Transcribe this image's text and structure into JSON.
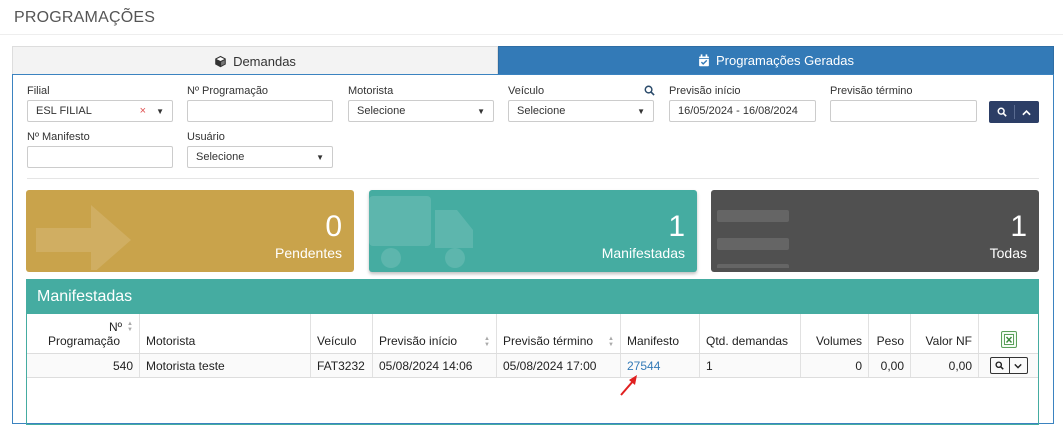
{
  "page": {
    "title": "PROGRAMAÇÕES"
  },
  "tabs": [
    {
      "label": "Demandas",
      "icon": "cube-icon",
      "active": false
    },
    {
      "label": "Programações Geradas",
      "icon": "calendar-check-icon",
      "active": true
    }
  ],
  "filters": {
    "filial": {
      "label": "Filial",
      "value": "ESL FILIAL",
      "clear": "×"
    },
    "n_programacao": {
      "label": "Nº Programação",
      "value": ""
    },
    "motorista": {
      "label": "Motorista",
      "value": "Selecione"
    },
    "veiculo": {
      "label": "Veículo",
      "value": "Selecione",
      "icon": "search-icon"
    },
    "previsao_inicio": {
      "label": "Previsão início",
      "value": "16/05/2024 - 16/08/2024"
    },
    "previsao_termino": {
      "label": "Previsão término",
      "value": ""
    },
    "n_manifesto": {
      "label": "Nº Manifesto",
      "value": ""
    },
    "usuario": {
      "label": "Usuário",
      "value": "Selecione"
    }
  },
  "cards": [
    {
      "count": "0",
      "label": "Pendentes",
      "color": "#c9a34b",
      "icon": "arrow-right-icon"
    },
    {
      "count": "1",
      "label": "Manifestadas",
      "color": "#45aca1",
      "icon": "truck-icon"
    },
    {
      "count": "1",
      "label": "Todas",
      "color": "#505050",
      "icon": "list-icon"
    }
  ],
  "manifestadas": {
    "title": "Manifestadas",
    "columns": {
      "n_programacao_1": "Nº",
      "n_programacao_2": "Programação",
      "motorista": "Motorista",
      "veiculo": "Veículo",
      "previsao_inicio": "Previsão início",
      "previsao_termino": "Previsão término",
      "manifesto": "Manifesto",
      "qtd_demandas": "Qtd. demandas",
      "volumes": "Volumes",
      "peso": "Peso",
      "valor_nf": "Valor NF"
    },
    "rows": [
      {
        "n_programacao": "540",
        "motorista": "Motorista teste",
        "veiculo": "FAT3232",
        "previsao_inicio": "05/08/2024 14:06",
        "previsao_termino": "05/08/2024 17:00",
        "manifesto": "27544",
        "qtd_demandas": "1",
        "volumes": "0",
        "peso": "0,00",
        "valor_nf": "0,00"
      }
    ]
  },
  "colors": {
    "primary": "#337ab7",
    "dark_button": "#2c3e66",
    "teal": "#45aca1",
    "gold": "#c9a34b",
    "dark": "#505050",
    "annotation_arrow": "#e02020"
  }
}
